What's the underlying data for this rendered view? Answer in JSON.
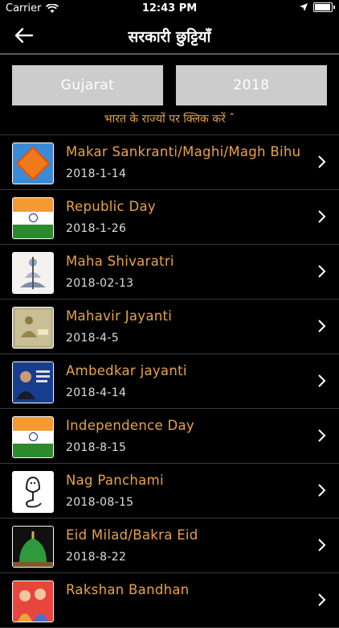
{
  "status_bar": {
    "carrier": "Carrier",
    "time": "12:43 PM"
  },
  "nav": {
    "title": "सरकारी छुट्टियाँ"
  },
  "selectors": {
    "state": "Gujarat",
    "year": "2018"
  },
  "hint": "भारत के राज्यों पर क्लिक करें ˆ",
  "holidays": [
    {
      "title": "Makar Sankranti/Maghi/Magh Bihu",
      "date": "2018-1-14",
      "icon": "kite-icon"
    },
    {
      "title": "Republic Day",
      "date": "2018-1-26",
      "icon": "india-flag-icon"
    },
    {
      "title": "Maha Shivaratri",
      "date": "2018-02-13",
      "icon": "shiva-icon"
    },
    {
      "title": "Mahavir Jayanti",
      "date": "2018-4-5",
      "icon": "mahavir-icon"
    },
    {
      "title": "Ambedkar jayanti",
      "date": "2018-4-14",
      "icon": "ambedkar-icon"
    },
    {
      "title": "Independence Day",
      "date": "2018-8-15",
      "icon": "india-flag-icon"
    },
    {
      "title": "Nag Panchami",
      "date": "2018-08-15",
      "icon": "cobra-icon"
    },
    {
      "title": "Eid Milad/Bakra Eid",
      "date": "2018-8-22",
      "icon": "mosque-icon"
    },
    {
      "title": "Rakshan Bandhan",
      "date": "",
      "icon": "rakhi-icon"
    }
  ],
  "colors": {
    "accent": "#e8a24a",
    "button_bg": "#cccccc",
    "background": "#000000"
  }
}
